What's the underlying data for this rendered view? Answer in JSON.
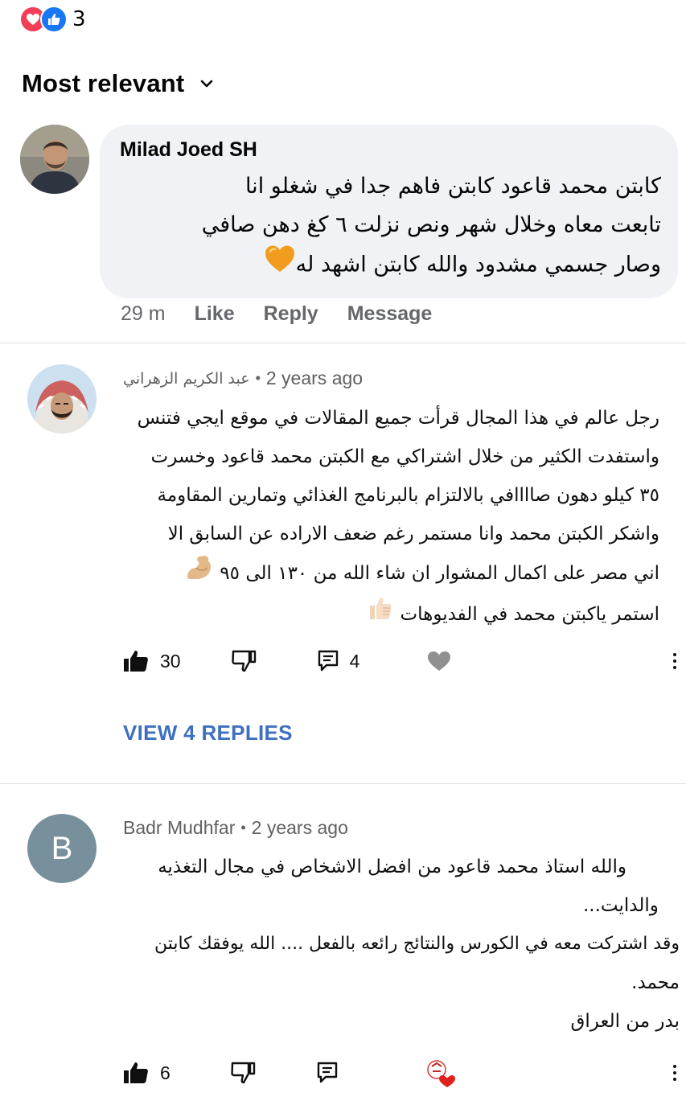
{
  "reactions": {
    "count": "3",
    "icons": [
      "love-icon",
      "like-icon"
    ],
    "colors": {
      "love": "#f33e58",
      "like": "#1877f2"
    }
  },
  "sort": {
    "label": "Most relevant"
  },
  "facebook_comment": {
    "author": "Milad Joed SH",
    "lines": [
      "كابتن محمد قاعود كابتن فاهم جدا في شغلو انا",
      "تابعت معاه وخلال شهر ونص نزلت ٦ كغ دهن صافي",
      "وصار جسمي مشدود والله كابتن اشهد له"
    ],
    "emoji": "orange-heart-icon",
    "time": "29 m",
    "actions": [
      "Like",
      "Reply",
      "Message"
    ]
  },
  "yt_comment_1": {
    "author": "عبد الكريم الزهراني",
    "time": "2 years ago",
    "lines": [
      "رجل عالم في هذا المجال قرأت جميع المقالات في موقع ايجي فتنس",
      "واستفدت الكثير من خلال اشتراكي مع الكبتن محمد قاعود وخسرت",
      "٣٥ كيلو دهون صاااافي بالالتزام بالبرنامج الغذائي وتمارين المقاومة",
      "واشكر الكبتن محمد وانا مستمر رغم ضعف الاراده عن السابق الا",
      "اني مصر على اكمال المشوار ان شاء الله من ١٣٠ الى ٩٥",
      "استمر ياكبتن محمد في الفديوهات"
    ],
    "emojis": [
      "flexed-biceps-icon",
      "thumbs-up-emoji-icon"
    ],
    "likes": "30",
    "replies_count": "4",
    "view_replies": "VIEW 4 REPLIES"
  },
  "yt_comment_2": {
    "author": "Badr Mudhfar",
    "avatar_letter": "B",
    "time": "2 years ago",
    "lines": [
      "والله استاذ محمد قاعود من افضل الاشخاص في مجال التغذيه",
      "والدايت...",
      "وقد اشتركت معه في الكورس والنتائج رائعه بالفعل .... الله يوفقك كابتن",
      "محمد.",
      "بدر من العراق"
    ],
    "likes": "6"
  }
}
